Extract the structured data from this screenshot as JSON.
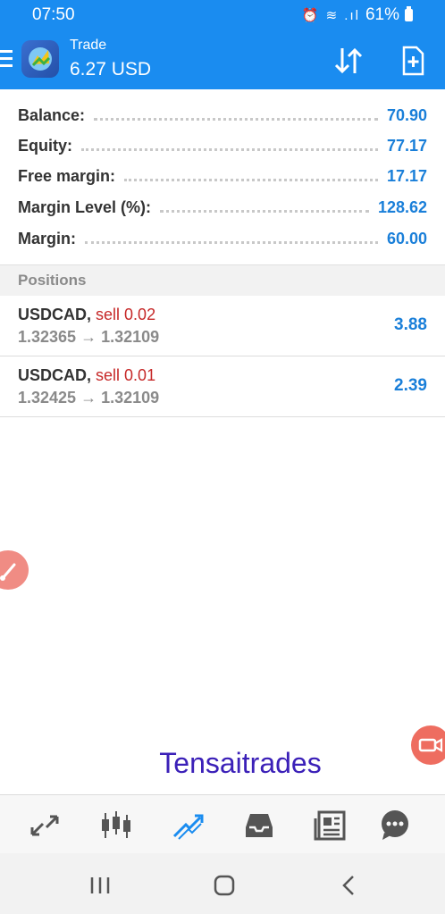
{
  "status": {
    "time": "07:50",
    "battery": "61%",
    "icons": "⏰ ≋ .ıl"
  },
  "header": {
    "title": "Trade",
    "subtitle": "6.27 USD",
    "menu_icon": "hamburger-icon",
    "logo_icon": "metatrader-logo",
    "sort_icon": "sort-arrows-icon",
    "new_order_icon": "new-order-icon"
  },
  "summary": [
    {
      "label": "Balance:",
      "value": "70.90"
    },
    {
      "label": "Equity:",
      "value": "77.17"
    },
    {
      "label": "Free margin:",
      "value": "17.17"
    },
    {
      "label": "Margin Level (%):",
      "value": "128.62"
    },
    {
      "label": "Margin:",
      "value": "60.00"
    }
  ],
  "positions": {
    "header": "Positions",
    "items": [
      {
        "symbol": "USDCAD,",
        "side": "sell 0.02",
        "prices": "1.32365 → 1.32109",
        "profit": "3.88"
      },
      {
        "symbol": "USDCAD,",
        "side": "sell 0.01",
        "prices": "1.32425 → 1.32109",
        "profit": "2.39"
      }
    ]
  },
  "watermark": "Tensaitrades",
  "nav": [
    "quotes-icon",
    "chart-icon",
    "trade-icon",
    "history-icon",
    "news-icon",
    "chat-icon"
  ],
  "colors": {
    "brand": "#1a8cf0",
    "value_blue": "#1a7fd9",
    "sell_red": "#c62828",
    "watermark": "#3b20b8"
  }
}
